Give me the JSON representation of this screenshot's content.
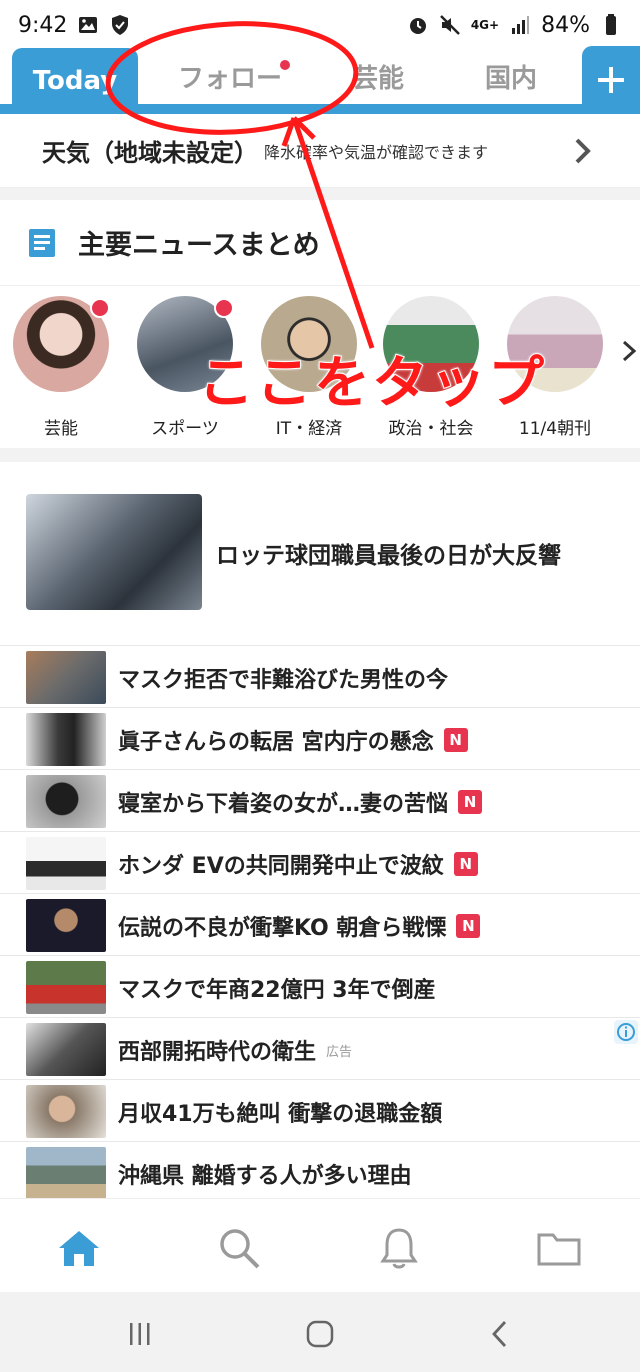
{
  "status_bar": {
    "time": "9:42",
    "network": "4G+",
    "battery": "84%"
  },
  "tabs": [
    {
      "label": "Today",
      "active": true
    },
    {
      "label": "フォロー",
      "has_dot": true
    },
    {
      "label": "芸能"
    },
    {
      "label": "国内"
    }
  ],
  "add_tab_icon": "plus-icon",
  "weather": {
    "title": "天気（地域未設定）",
    "subtitle": "降水確率や気温が確認できます"
  },
  "summary": {
    "title": "主要ニュースまとめ"
  },
  "stories": [
    {
      "label": "芸能",
      "has_dot": true,
      "color": "#d9a8a0"
    },
    {
      "label": "スポーツ",
      "has_dot": true,
      "color": "#7c8796"
    },
    {
      "label": "IT・経済",
      "has_dot": false,
      "color": "#b9a98f"
    },
    {
      "label": "政治・社会",
      "has_dot": false,
      "color": "#4a8a5c"
    },
    {
      "label": "11/4朝刊",
      "has_dot": false,
      "color": "#c9a6b8"
    }
  ],
  "headline": {
    "title": "ロッテ球団職員最後の日が大反響"
  },
  "news": [
    {
      "title": "マスク拒否で非難浴びた男性の今",
      "badge": "",
      "ad": false,
      "color": "#6b6b6b"
    },
    {
      "title": "眞子さんらの転居 宮内庁の懸念",
      "badge": "N",
      "ad": false,
      "color": "#3a3a3a"
    },
    {
      "title": "寝室から下着姿の女が…妻の苦悩",
      "badge": "N",
      "ad": false,
      "color": "#9a9a9a"
    },
    {
      "title": "ホンダ EVの共同開発中止で波紋",
      "badge": "N",
      "ad": false,
      "color": "#dcdcdc"
    },
    {
      "title": "伝説の不良が衝撃KO 朝倉ら戦慄",
      "badge": "N",
      "ad": false,
      "color": "#2a2a2a"
    },
    {
      "title": "マスクで年商22億円 3年で倒産",
      "badge": "",
      "ad": false,
      "color": "#b8342c"
    },
    {
      "title": "西部開拓時代の衛生",
      "badge": "",
      "ad": true,
      "ad_label": "広告",
      "color": "#555555"
    },
    {
      "title": "月収41万も絶叫 衝撃の退職金額",
      "badge": "",
      "ad": false,
      "color": "#8a7a6a"
    },
    {
      "title": "沖縄県 離婚する人が多い理由",
      "badge": "",
      "ad": false,
      "color": "#6a7f72"
    }
  ],
  "bottom_nav": [
    "home-icon",
    "search-icon",
    "bell-icon",
    "folder-icon"
  ],
  "annotation": {
    "text": "ここをタップ",
    "color": "#ff1a1a"
  },
  "colors": {
    "accent": "#3b9dd6",
    "badge": "#e8354f"
  }
}
